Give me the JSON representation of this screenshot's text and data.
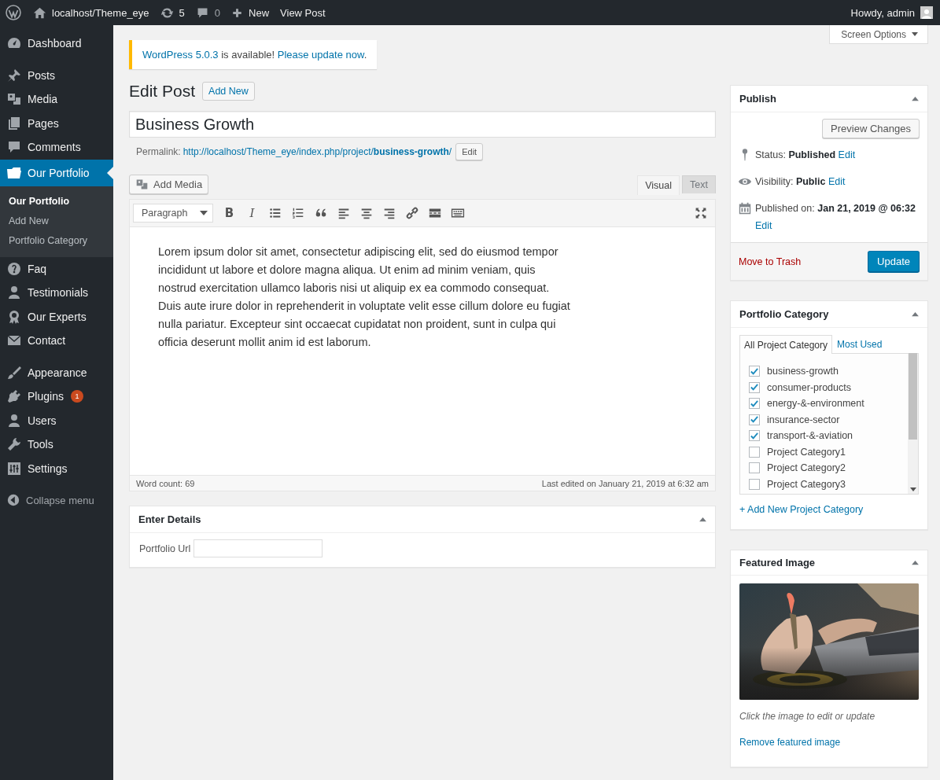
{
  "admin_bar": {
    "site": "localhost/Theme_eye",
    "updates": "5",
    "comments": "0",
    "new": "New",
    "view": "View Post",
    "greeting": "Howdy, admin"
  },
  "sidebar": {
    "groups": [
      [
        {
          "label": "Dashboard",
          "selected": false
        }
      ],
      [
        {
          "label": "Posts",
          "selected": false
        },
        {
          "label": "Media",
          "selected": false
        },
        {
          "label": "Pages",
          "selected": false
        },
        {
          "label": "Comments",
          "selected": false
        },
        {
          "label": "Our Portfolio",
          "selected": true,
          "children": [
            {
              "label": "Our Portfolio",
              "selected": true
            },
            {
              "label": "Add New",
              "selected": false
            },
            {
              "label": "Portfolio Category",
              "selected": false
            }
          ]
        },
        {
          "label": "Faq",
          "selected": false
        },
        {
          "label": "Testimonials",
          "selected": false
        },
        {
          "label": "Our Experts",
          "selected": false
        },
        {
          "label": "Contact",
          "selected": false
        }
      ],
      [
        {
          "label": "Appearance",
          "selected": false
        },
        {
          "label": "Plugins",
          "selected": false,
          "badge": "1"
        },
        {
          "label": "Users",
          "selected": false
        },
        {
          "label": "Tools",
          "selected": false
        },
        {
          "label": "Settings",
          "selected": false
        }
      ]
    ],
    "collapse": "Collapse menu"
  },
  "screen_options": "Screen Options",
  "notice": {
    "version_link": "WordPress 5.0.3",
    "text": " is available! ",
    "update_link": "Please update now",
    "end": "."
  },
  "heading": {
    "title": "Edit Post",
    "add_new": "Add New"
  },
  "post_title": "Business Growth",
  "permalink": {
    "label": "Permalink:",
    "url": "http://localhost/Theme_eye/index.php/project/**business-growth**/",
    "edit": "Edit"
  },
  "editor": {
    "add_media": "Add Media",
    "tabs": [
      {
        "label": "Visual",
        "selected": true
      },
      {
        "label": "Text",
        "selected": false
      }
    ],
    "toolbar": {
      "format": "Paragraph",
      "bold": "B",
      "italic": "I"
    },
    "content": "Lorem ipsum dolor sit amet, consectetur adipiscing elit, sed do eiusmod tempor incididunt ut labore et dolore magna aliqua. Ut enim ad minim veniam, quis nostrud exercitation ullamco laboris nisi ut aliquip ex ea commodo consequat. Duis aute irure dolor in reprehenderit in voluptate velit esse cillum dolore eu fugiat nulla pariatur. Excepteur sint occaecat cupidatat non proident, sunt in culpa qui officia deserunt mollit anim id est laborum.",
    "word_count": "Word count: 69",
    "last_edited": "Last edited on January 21, 2019 at 6:32 am"
  },
  "enter_details": {
    "title": "Enter Details",
    "field_label": "Portfolio Url"
  },
  "publish": {
    "title": "Publish",
    "preview": "Preview Changes",
    "rows": [
      {
        "label": "Status:",
        "value": "Published",
        "link": "Edit"
      },
      {
        "label": "Visibility:",
        "value": "Public",
        "link": "Edit"
      },
      {
        "label": "Published on:",
        "value": "Jan 21, 2019 @ 06:32",
        "link": "Edit"
      }
    ],
    "trash": "Move to Trash",
    "update": "Update"
  },
  "portfolio_category": {
    "title": "Portfolio Category",
    "tabs": [
      {
        "label": "All Project Category",
        "selected": true
      },
      {
        "label": "Most Used",
        "selected": false
      }
    ],
    "items": [
      {
        "label": "business-growth",
        "checked": true
      },
      {
        "label": "consumer-products",
        "checked": true
      },
      {
        "label": "energy-&-environment",
        "checked": true
      },
      {
        "label": "insurance-sector",
        "checked": true
      },
      {
        "label": "transport-&-aviation",
        "checked": true
      },
      {
        "label": "Project Category1",
        "checked": false
      },
      {
        "label": "Project Category2",
        "checked": false
      },
      {
        "label": "Project Category3",
        "checked": false
      }
    ],
    "add_new": "+ Add New Project Category"
  },
  "featured_image": {
    "title": "Featured Image",
    "caption": "Click the image to edit or update",
    "remove": "Remove featured image"
  }
}
